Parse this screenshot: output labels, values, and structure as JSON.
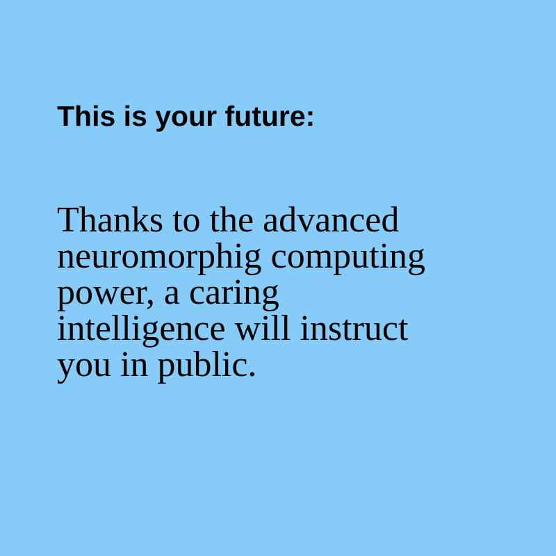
{
  "colors": {
    "background": "#87CBF8",
    "text": "#000000"
  },
  "heading": "This is your future:",
  "body_lines": [
    "Thanks to the advanced",
    "neuromorphig computing",
    "power, a caring",
    "intelligence will instruct",
    "you in public."
  ]
}
